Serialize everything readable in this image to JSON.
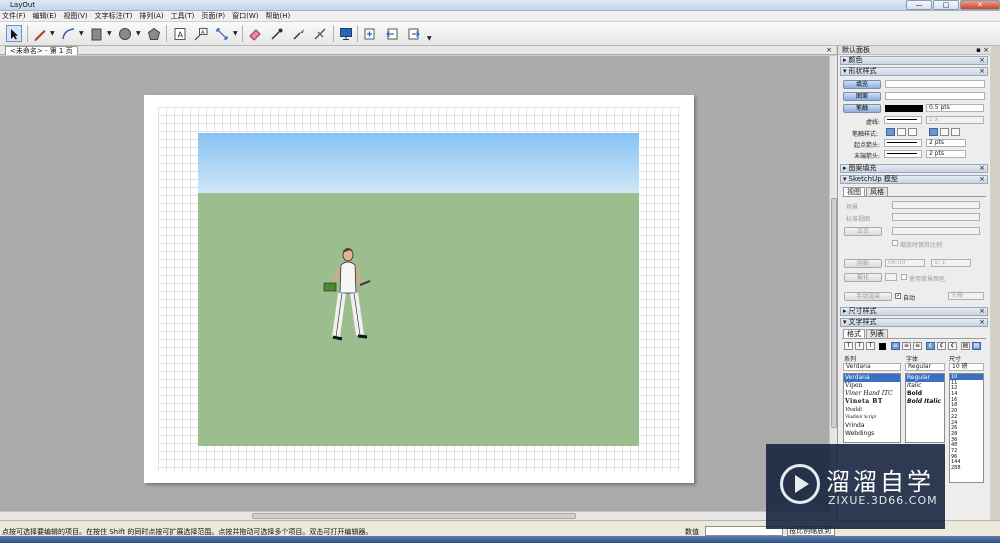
{
  "window": {
    "title": "LayOut",
    "minimize": "—",
    "maximize": "□",
    "close": "✕"
  },
  "menu": [
    "文件(F)",
    "编辑(E)",
    "视图(V)",
    "文字标注(T)",
    "排列(A)",
    "工具(T)",
    "页面(P)",
    "窗口(W)",
    "帮助(H)"
  ],
  "toolbar": {
    "icons": [
      "select-arrow-icon",
      "pencil-icon",
      "arc-icon",
      "rectangle-icon",
      "circle-icon",
      "polygon-icon",
      "text-icon",
      "label-icon",
      "dimension-icon",
      "eraser-icon",
      "eyedropper-icon",
      "split-icon",
      "join-icon",
      "presentation-icon",
      "add-page-icon",
      "previous-page-icon",
      "next-page-icon"
    ]
  },
  "document_tab": {
    "label": "<未命名> - 第 1 页",
    "close": "×"
  },
  "canvas": {
    "sky_color": "#9ccdf3",
    "ground_color": "#9cbd8e"
  },
  "status": {
    "message": "点按可选择要编辑的项目。在按住 Shift 的同时点按可扩展选择范围。点按并拖动可选择多个项目。双击可打开编辑器。",
    "value_label": "数值",
    "zoom": "按比例缩放到"
  },
  "panel": {
    "title": "默认面板",
    "sections": {
      "color": "颜色",
      "shape_style": "形状样式",
      "pattern_fill": "图案填充",
      "sketchup_model": "SketchUp 模型",
      "dimension_style": "尺寸样式",
      "text_style": "文字样式"
    },
    "shape": {
      "fill": "填充",
      "pattern": "图案",
      "stroke": "笔触",
      "stroke_width": "0.5 pts",
      "dash_label": "虚线:",
      "dash_value": "1 x",
      "stroke_style_label": "笔触样式:",
      "start_arrow_label": "起点箭头:",
      "start_arrow_value": "2 pts",
      "end_arrow_label": "末端箭头:",
      "end_arrow_value": "2 pts"
    },
    "sketchup": {
      "tabs": [
        "视图",
        "风格"
      ],
      "scene_label": "场景",
      "standard_view_label": "标准视图",
      "ortho_button": "正交",
      "keep_scale": "缩放时保持比例",
      "shadow_button": "阴影",
      "time": "06:00",
      "date": "1/ 1",
      "fog_button": "雾化",
      "use_bg": "使用背景颜色",
      "render_button": "手动渲染",
      "auto_label": "自动",
      "render_mode": "光栅"
    },
    "text": {
      "tabs": [
        "格式",
        "列表"
      ],
      "family_label": "系列",
      "typeface_label": "字体",
      "size_label": "尺寸",
      "family_value": "Verdana",
      "typeface_value": "Regular",
      "size_value": "10 磅",
      "families": [
        "Verdana",
        "Viner Hand ITC",
        "Vivaldi",
        "Vladimir Script",
        "Vrinda",
        "Webdings"
      ],
      "family_samples": [
        "Verdana",
        "Vipen",
        "Viner Hand ITC",
        "Vineta BT",
        "Vivaldi",
        "Vladimir Script",
        "Vrinda",
        "Webdings"
      ],
      "typefaces": [
        "Regular",
        "Italic",
        "Bold",
        "Bold Italic"
      ],
      "sizes": [
        "10",
        "11",
        "12",
        "14",
        "16",
        "18",
        "20",
        "22",
        "24",
        "26",
        "28",
        "36",
        "48",
        "72",
        "96",
        "144",
        "288"
      ]
    }
  },
  "watermark": {
    "brand": "溜溜自学",
    "url": "ZIXUE.3D66.COM"
  }
}
